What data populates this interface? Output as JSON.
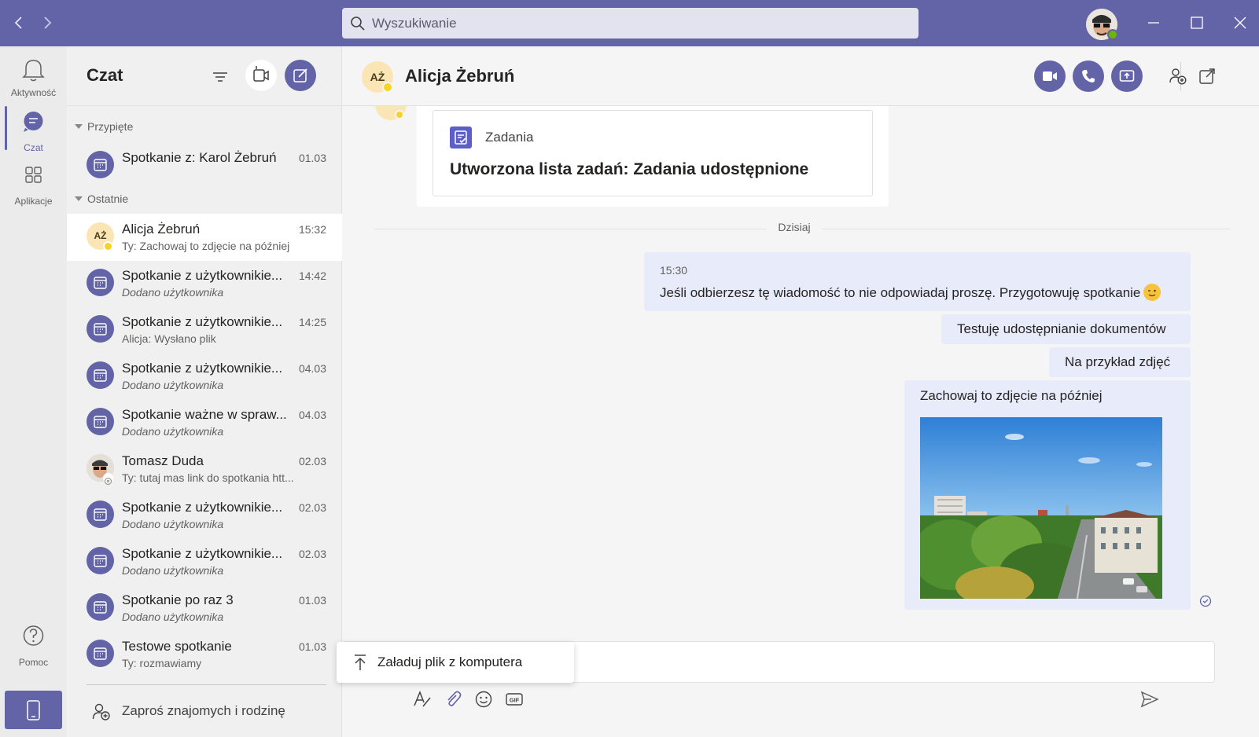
{
  "titlebar": {
    "search_placeholder": "Wyszukiwanie"
  },
  "rail": {
    "items": [
      {
        "label": "Aktywność",
        "icon": "bell-icon"
      },
      {
        "label": "Czat",
        "icon": "chat-icon"
      },
      {
        "label": "Aplikacje",
        "icon": "apps-icon"
      },
      {
        "label": "Pomoc",
        "icon": "help-icon"
      }
    ],
    "active": "Czat"
  },
  "chatlist": {
    "title": "Czat",
    "pinned_label": "Przypięte",
    "recent_label": "Ostatnie",
    "pinned": [
      {
        "name": "Spotkanie z: Karol Żebruń",
        "time": "01.03"
      }
    ],
    "recent": [
      {
        "name": "Alicja Żebruń",
        "time": "15:32",
        "preview": "Ty: Zachowaj to zdjęcie na później",
        "initials": "AŻ"
      },
      {
        "name": "Spotkanie z użytkownikie...",
        "time": "14:42",
        "preview": "Dodano użytkownika"
      },
      {
        "name": "Spotkanie z użytkownikie...",
        "time": "14:25",
        "preview": "Alicja: Wysłano plik"
      },
      {
        "name": "Spotkanie z użytkownikie...",
        "time": "04.03",
        "preview": "Dodano użytkownika"
      },
      {
        "name": "Spotkanie ważne w spraw...",
        "time": "04.03",
        "preview": "Dodano użytkownika"
      },
      {
        "name": "Tomasz Duda",
        "time": "02.03",
        "preview": "Ty: tutaj mas link do spotkania htt..."
      },
      {
        "name": "Spotkanie z użytkownikie...",
        "time": "02.03",
        "preview": "Dodano użytkownika"
      },
      {
        "name": "Spotkanie z użytkownikie...",
        "time": "02.03",
        "preview": "Dodano użytkownika"
      },
      {
        "name": "Spotkanie po raz 3",
        "time": "01.03",
        "preview": "Dodano użytkownika"
      },
      {
        "name": "Testowe spotkanie",
        "time": "01.03",
        "preview": "Ty: rozmawiamy"
      }
    ],
    "invite_label": "Zaproś znajomych i rodzinę"
  },
  "chat": {
    "contact_name": "Alicja Żebruń",
    "contact_initials": "AŻ",
    "task_card": {
      "app_name": "Zadania",
      "title": "Utworzona lista zadań: Zadania udostępnione"
    },
    "day_label": "Dzisiaj",
    "messages": [
      {
        "time": "15:30",
        "text": "Jeśli odbierzesz tę wiadomość to nie odpowiadaj proszę. Przygotowuję spotkanie"
      },
      {
        "text": "Testuję udostępnianie dokumentów"
      },
      {
        "text": "Na przykład zdjęć"
      },
      {
        "text": "Zachowaj to zdjęcie na później"
      }
    ],
    "upload_menu_label": "Załaduj plik z komputera"
  },
  "colors": {
    "brand": "#6264a7",
    "bubble": "#e8ebfa",
    "away": "#f8d22a",
    "online": "#6bb700"
  }
}
